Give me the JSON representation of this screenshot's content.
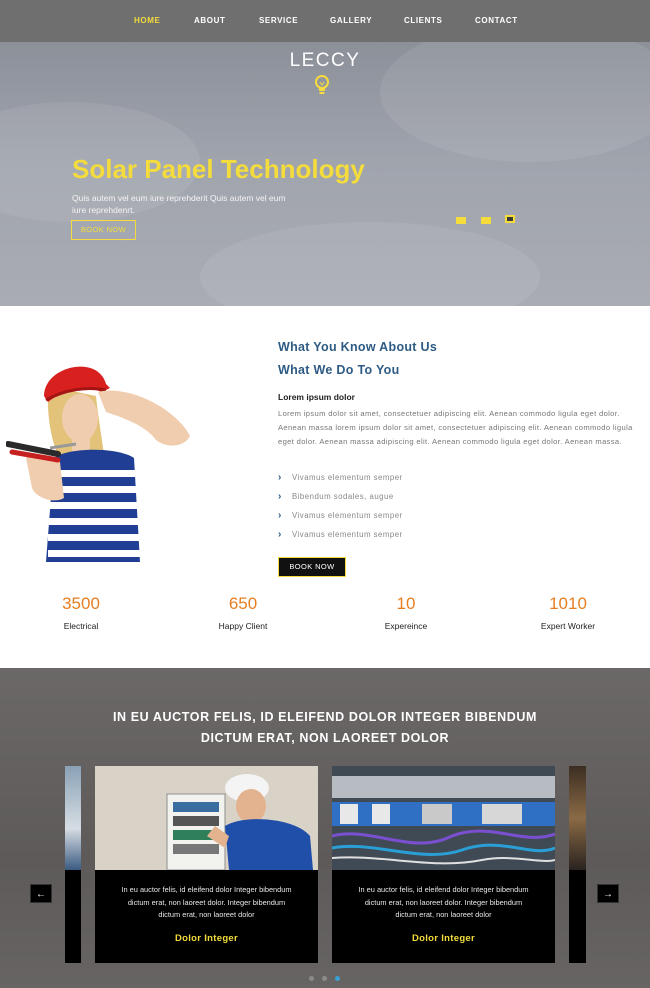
{
  "nav": {
    "items": [
      "HOME",
      "ABOUT",
      "SERVICE",
      "GALLERY",
      "CLIENTS",
      "CONTACT"
    ],
    "active_index": 0
  },
  "hero": {
    "brand": "LECCY",
    "title": "Solar Panel Technology",
    "text": "Quis autem vel eum iure reprehderit Quis autem vel eum iure reprehdenrt.",
    "button": "BOOK NOW",
    "slides_count": 3,
    "active_slide": 3
  },
  "about": {
    "heading1": "What You Know About Us",
    "heading2": "What We Do To You",
    "subheading": "Lorem ipsum dolor",
    "paragraph": "Lorem ipsum dolor sit amet, consectetuer adipiscing elit. Aenean commodo ligula eget dolor. Aenean massa lorem ipsum dolor sit amet, consectetuer adipiscing elit. Aenean commodo ligula eget dolor. Aenean massa adipiscing elit. Aenean commodo ligula eget dolor. Aenean massa.",
    "list": [
      "Vivamus elementum semper",
      "Bibendum sodales, augue",
      "Vivamus elementum semper",
      "Vivamus elementum semper"
    ],
    "button": "BOOK NOW"
  },
  "stats": [
    {
      "value": "3500",
      "label": "Electrical"
    },
    {
      "value": "650",
      "label": "Happy Client"
    },
    {
      "value": "10",
      "label": "Expereince"
    },
    {
      "value": "1010",
      "label": "Expert Worker"
    }
  ],
  "services": {
    "heading_line1": "IN EU AUCTOR FELIS, ID ELEIFEND DOLOR INTEGER BIBENDUM",
    "heading_line2": "DICTUM ERAT, NON LAOREET DOLOR",
    "cards": [
      {
        "text": "In eu auctor felis, id eleifend dolor Integer bibendum dictum erat, non laoreet dolor. Integer bibendum dictum erat, non laoreet dolor",
        "title": "Dolor Integer"
      },
      {
        "text": "In eu auctor felis, id eleifend dolor Integer bibendum dictum erat, non laoreet dolor. Integer bibendum dictum erat, non laoreet dolor",
        "title": "Dolor Integer"
      }
    ],
    "prev_icon": "←",
    "next_icon": "→",
    "active_dot": 3
  },
  "colors": {
    "accent": "#f3dc3b",
    "heading_blue": "#2d5b84",
    "stat_orange": "#e67e22",
    "nav_bg": "#6f6f6f"
  }
}
